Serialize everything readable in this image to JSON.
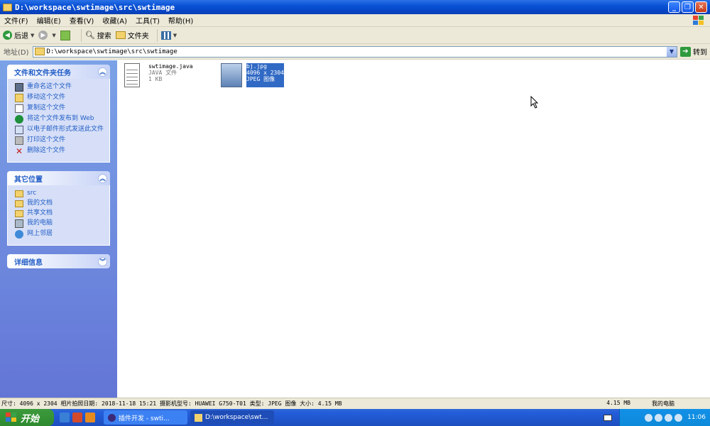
{
  "window": {
    "title": "D:\\workspace\\swtimage\\src\\swtimage",
    "minimize": "_",
    "restore": "❐",
    "close": "✕"
  },
  "menu": [
    "文件(F)",
    "编辑(E)",
    "查看(V)",
    "收藏(A)",
    "工具(T)",
    "帮助(H)"
  ],
  "toolbar": {
    "back": "后退",
    "search": "搜索",
    "folders": "文件夹"
  },
  "address": {
    "label": "地址(D)",
    "path": "D:\\workspace\\swtimage\\src\\swtimage",
    "go": "转到"
  },
  "tasks_panel": {
    "title": "文件和文件夹任务",
    "items": [
      {
        "label": "重命名这个文件",
        "icon": "rename-icon"
      },
      {
        "label": "移动这个文件",
        "icon": "move-icon"
      },
      {
        "label": "复制这个文件",
        "icon": "copy-icon"
      },
      {
        "label": "将这个文件发布到 Web",
        "icon": "web-publish-icon"
      },
      {
        "label": "以电子邮件形式发送此文件",
        "icon": "email-icon"
      },
      {
        "label": "打印这个文件",
        "icon": "print-icon"
      },
      {
        "label": "删除这个文件",
        "icon": "delete-icon"
      }
    ]
  },
  "places_panel": {
    "title": "其它位置",
    "items": [
      {
        "label": "src",
        "icon": "folder-icon"
      },
      {
        "label": "我的文档",
        "icon": "folder-icon"
      },
      {
        "label": "共享文档",
        "icon": "folder-icon"
      },
      {
        "label": "我的电脑",
        "icon": "computer-icon"
      },
      {
        "label": "网上邻居",
        "icon": "network-icon"
      }
    ]
  },
  "details_panel": {
    "title": "详细信息"
  },
  "files": [
    {
      "name": "swtimage.java",
      "type": "JAVA 文件",
      "size": "1 KB",
      "selected": false
    },
    {
      "name": "bj.jpg",
      "dims": "4096 x 2304",
      "type": "JPEG 图像",
      "selected": true
    }
  ],
  "status": {
    "text": "尺寸: 4096 x 2304 相片拍照日期: 2018-11-18 15:21 摄影机型号: HUAWEI G750-T01 类型: JPEG 图像 大小: 4.15 MB",
    "size": "4.15 MB",
    "zone": "我的电脑"
  },
  "taskbar": {
    "start": "开始",
    "tasks": [
      {
        "label": "插件开发 - swti..."
      },
      {
        "label": "D:\\workspace\\swt..."
      }
    ],
    "clock": "11:06"
  }
}
